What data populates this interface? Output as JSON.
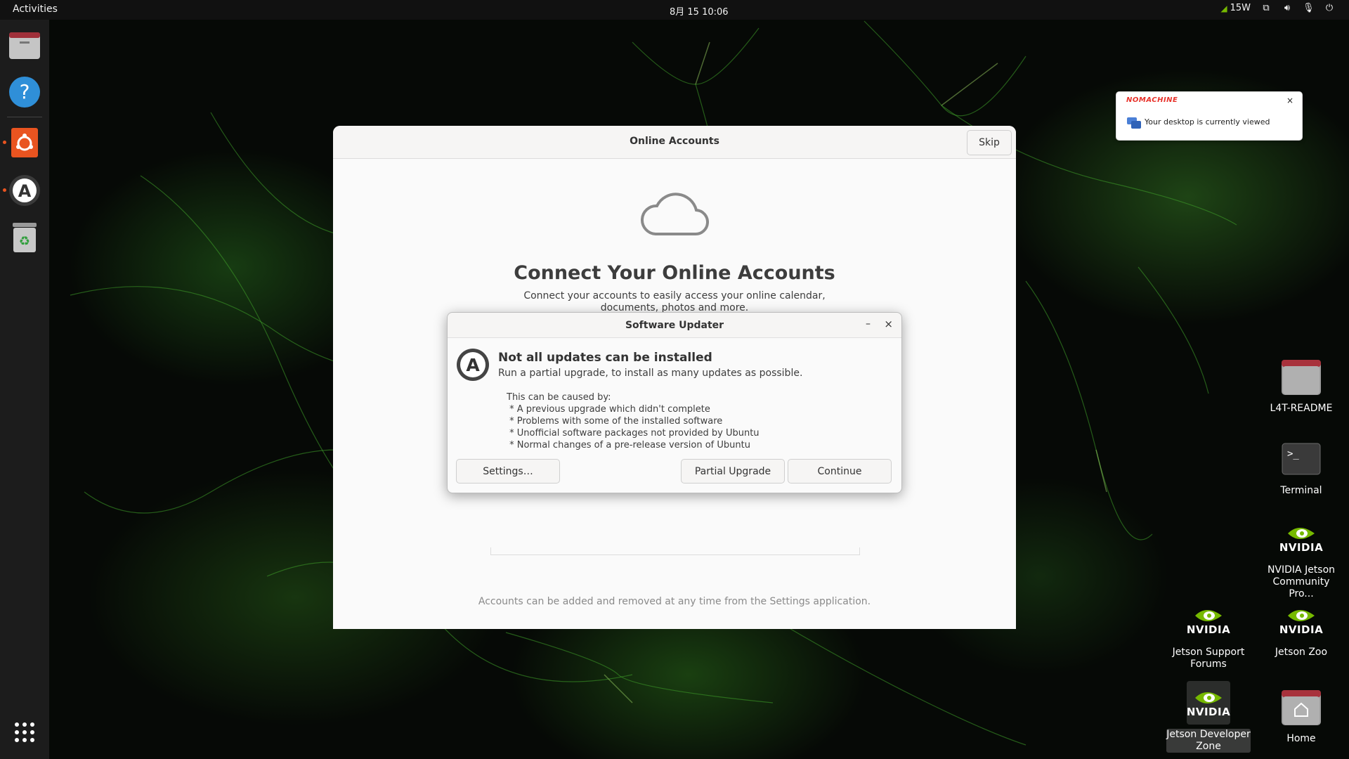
{
  "topbar": {
    "activities": "Activities",
    "clock": "8月 15  10:06",
    "power_label": "15W"
  },
  "dock": {
    "items": [
      "files-icon",
      "help-icon",
      "ubuntu-software-icon",
      "software-updater-icon",
      "trash-icon",
      "app-grid-icon"
    ]
  },
  "online_accounts": {
    "title": "Online Accounts",
    "skip": "Skip",
    "heading": "Connect Your Online Accounts",
    "description": "Connect your accounts to easily access your online calendar, documents, photos and more.",
    "footer": "Accounts can be added and removed at any time from the Settings application."
  },
  "software_updater": {
    "title": "Software Updater",
    "minimize": "–",
    "close": "×",
    "heading": "Not all updates can be installed",
    "subheading": "Run a partial upgrade, to install as many updates as possible.",
    "causes_intro": "This can be caused by:",
    "causes": [
      " * A previous upgrade which didn't complete",
      " * Problems with some of the installed software",
      " * Unofficial software packages not provided by Ubuntu",
      " * Normal changes of a pre-release version of Ubuntu"
    ],
    "buttons": {
      "settings": "Settings…",
      "partial_upgrade": "Partial Upgrade",
      "continue": "Continue"
    }
  },
  "nomachine": {
    "brand": "NOMACHINE",
    "close": "×",
    "message": "Your desktop is currently viewed"
  },
  "desktop_icons": {
    "l4t_readme": "L4T-README",
    "terminal": "Terminal",
    "community": "NVIDIA Jetson Community Pro...",
    "support_forums": "Jetson Support Forums",
    "zoo": "Jetson Zoo",
    "developer_zone": "Jetson Developer Zone",
    "home": "Home",
    "nvidia_word": "NVIDIA"
  },
  "colors": {
    "accent": "#e95420",
    "nvidia_green": "#76b900",
    "nomachine_red": "#e8322a"
  }
}
